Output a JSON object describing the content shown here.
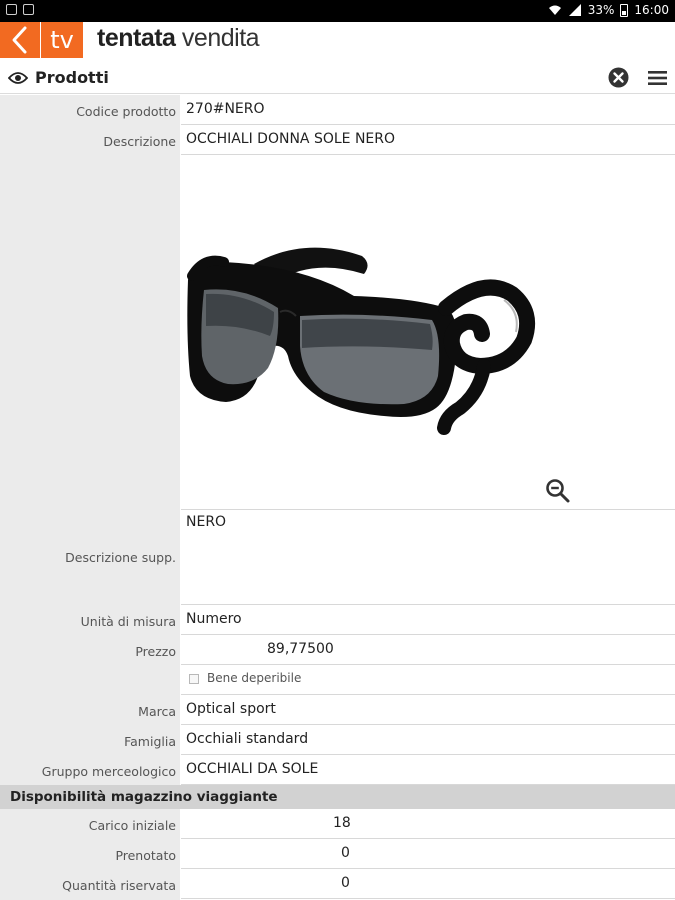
{
  "status_bar": {
    "battery": "33%",
    "time": "16:00",
    "icons": [
      "gallery-icon",
      "screenshot-icon",
      "wifi-icon",
      "signal-icon",
      "battery-icon"
    ]
  },
  "app": {
    "logo": "tv",
    "brand_bold": "tentata",
    "brand_light": "vendita",
    "accent": "#f26a21"
  },
  "toolbar": {
    "title": "Prodotti",
    "icons": [
      "eye-icon",
      "close-icon",
      "menu-icon"
    ]
  },
  "form": {
    "codice_label": "Codice prodotto",
    "codice_value": "270#NERO",
    "descrizione_label": "Descrizione",
    "descrizione_value": "OCCHIALI DONNA SOLE NERO",
    "image_icon": "zoom-out-icon",
    "desc_supp_label": "Descrizione supp.",
    "desc_supp_value": "NERO",
    "unita_label": "Unità di misura",
    "unita_value": "Numero",
    "prezzo_label": "Prezzo",
    "prezzo_value": "89,77500",
    "deperibile_label": "Bene deperibile",
    "deperibile_checked": false,
    "marca_label": "Marca",
    "marca_value": "Optical sport",
    "famiglia_label": "Famiglia",
    "famiglia_value": "Occhiali standard",
    "gruppo_label": "Gruppo merceologico",
    "gruppo_value": "OCCHIALI DA SOLE"
  },
  "section": {
    "title": "Disponibilità magazzino viaggiante",
    "carico_label": "Carico iniziale",
    "carico_value": "18",
    "prenotato_label": "Prenotato",
    "prenotato_value": "0",
    "riservata_label": "Quantità riservata",
    "riservata_value": "0"
  }
}
